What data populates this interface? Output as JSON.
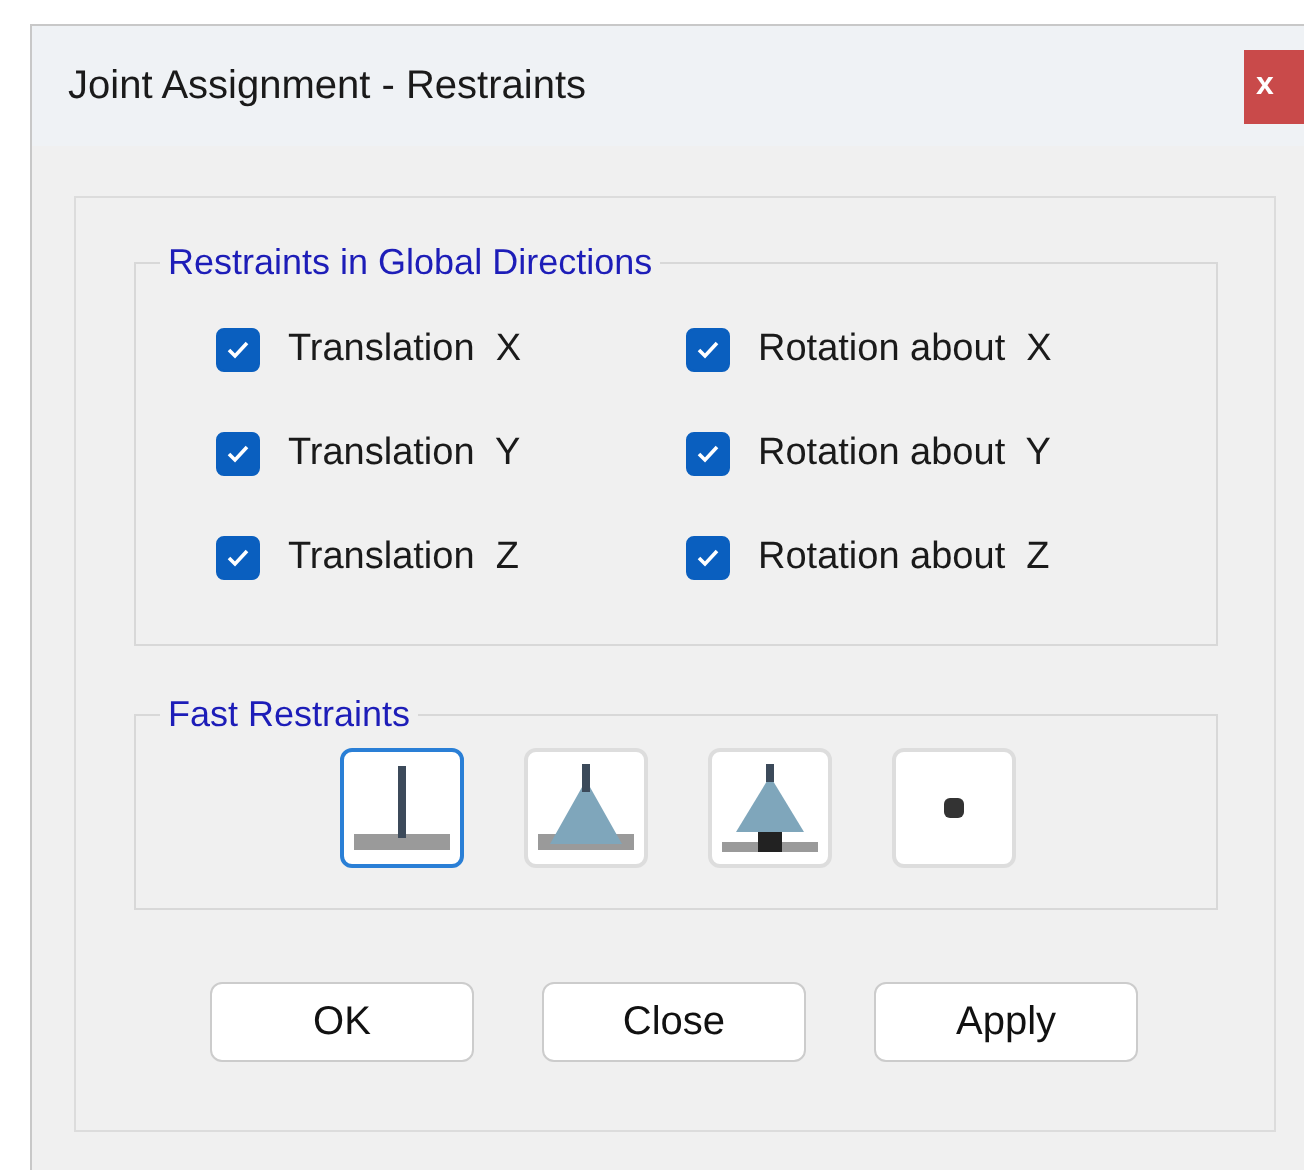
{
  "window": {
    "title": "Joint Assignment - Restraints",
    "close_label": "x"
  },
  "global_directions": {
    "title": "Restraints in Global Directions",
    "checkboxes": [
      {
        "label": "Translation  X",
        "checked": true
      },
      {
        "label": "Rotation about  X",
        "checked": true
      },
      {
        "label": "Translation  Y",
        "checked": true
      },
      {
        "label": "Rotation about  Y",
        "checked": true
      },
      {
        "label": "Translation  Z",
        "checked": true
      },
      {
        "label": "Rotation about  Z",
        "checked": true
      }
    ]
  },
  "fast_restraints": {
    "title": "Fast Restraints",
    "buttons": [
      {
        "kind": "fixed",
        "selected": true
      },
      {
        "kind": "pinned",
        "selected": false
      },
      {
        "kind": "roller",
        "selected": false
      },
      {
        "kind": "free",
        "selected": false
      }
    ]
  },
  "buttons": [
    "OK",
    "Close",
    "Apply"
  ]
}
